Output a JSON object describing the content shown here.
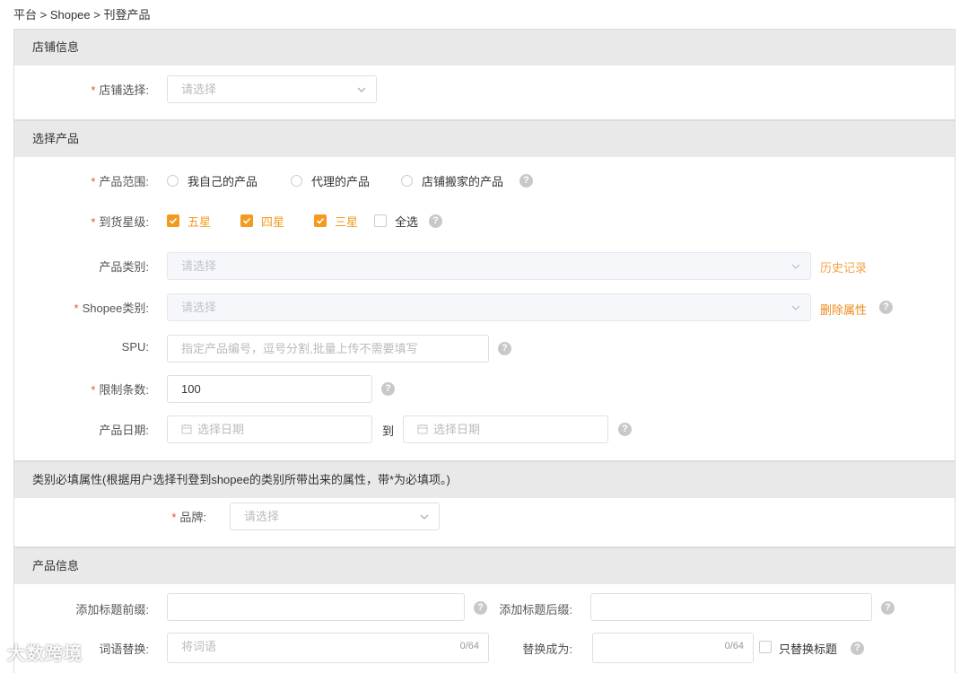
{
  "breadcrumb": "平台 > Shopee > 刊登产品",
  "store_section": {
    "title": "店铺信息",
    "store_label": "店铺选择:",
    "store_placeholder": "请选择"
  },
  "product_section": {
    "title": "选择产品",
    "scope_label": "产品范围:",
    "scope_options": [
      "我自己的产品",
      "代理的产品",
      "店铺搬家的产品"
    ],
    "rating_label": "到货星级:",
    "rating_options": [
      {
        "label": "五星",
        "checked": true
      },
      {
        "label": "四星",
        "checked": true
      },
      {
        "label": "三星",
        "checked": true
      },
      {
        "label": "全选",
        "checked": false
      }
    ],
    "category_label": "产品类别:",
    "category_placeholder": "请选择",
    "history_link": "历史记录",
    "shopee_category_label": "Shopee类别:",
    "shopee_category_placeholder": "请选择",
    "delete_attr_link": "删除属性",
    "spu_label": "SPU:",
    "spu_placeholder": "指定产品编号，逗号分割,批量上传不需要填写",
    "limit_label": "限制条数:",
    "limit_value": "100",
    "date_label": "产品日期:",
    "date_start_placeholder": "选择日期",
    "date_to": "到",
    "date_end_placeholder": "选择日期"
  },
  "attr_section": {
    "title": "类别必填属性(根据用户选择刊登到shopee的类别所带出来的属性，带*为必填项。)",
    "brand_label": "品牌:",
    "brand_placeholder": "请选择"
  },
  "info_section": {
    "title": "产品信息",
    "prefix_label": "添加标题前缀:",
    "suffix_label": "添加标题后缀:",
    "replace_label": "词语替换:",
    "replace_placeholder": "将词语",
    "replace_count": "0/64",
    "replace_to_label": "替换成为:",
    "replace_to_count": "0/64",
    "only_title_label": "只替换标题"
  },
  "watermark": "大数跨境",
  "colors": {
    "accent": "#f39a1f",
    "required": "#e74c3c",
    "section_bg": "#e9e9e9"
  }
}
